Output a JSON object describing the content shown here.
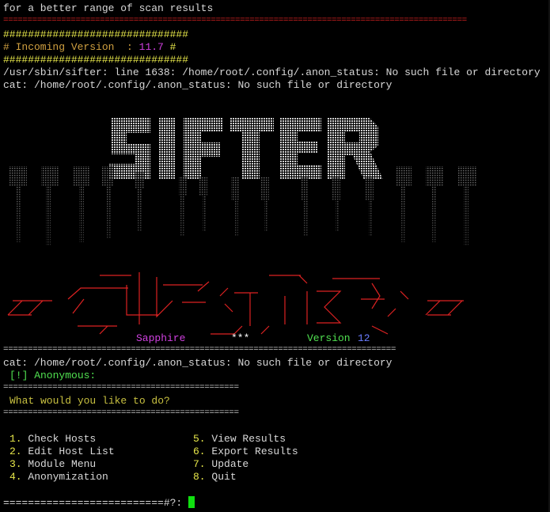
{
  "header_text": "for a better range of scan results",
  "red_rule": "================================================================================================",
  "version_box": {
    "border": "##############################",
    "label": "# Incoming Version  : ",
    "version": "11.7",
    "tail": " #"
  },
  "errors": [
    "/usr/sbin/sifter: line 1638: /home/root/.config/.anon_status: No such file or directory",
    "cat: /home/root/.config/.anon_status: No such file or directory"
  ],
  "banner": {
    "logo_word": "SIFTER",
    "edition_name": "Sapphire",
    "stars": "***",
    "version_label": "Version",
    "version_number": "12"
  },
  "divider_long": "================================================================================",
  "status_error": "cat: /home/root/.config/.anon_status: No such file or directory",
  "anon_status": "[!] Anonymous:",
  "divider_mid": "================================================",
  "prompt_question": "What would you like to do?",
  "menu": {
    "left": [
      {
        "num": "1.",
        "label": "Check Hosts"
      },
      {
        "num": "2.",
        "label": "Edit Host List"
      },
      {
        "num": "3.",
        "label": "Module Menu"
      },
      {
        "num": "4.",
        "label": "Anonymization"
      }
    ],
    "right": [
      {
        "num": "5.",
        "label": "View Results"
      },
      {
        "num": "6.",
        "label": "Export Results"
      },
      {
        "num": "7.",
        "label": "Update"
      },
      {
        "num": "8.",
        "label": "Quit"
      }
    ]
  },
  "input_prompt": "==========================#?: ",
  "colors": {
    "background": "#000000",
    "text": "#c0c0c0",
    "rule_red": "#dd2222",
    "accent_yellow": "#e8e84a",
    "accent_magenta": "#d040e0",
    "accent_green": "#50e050",
    "accent_blue": "#6a7cff",
    "cursor_green": "#10e010"
  }
}
